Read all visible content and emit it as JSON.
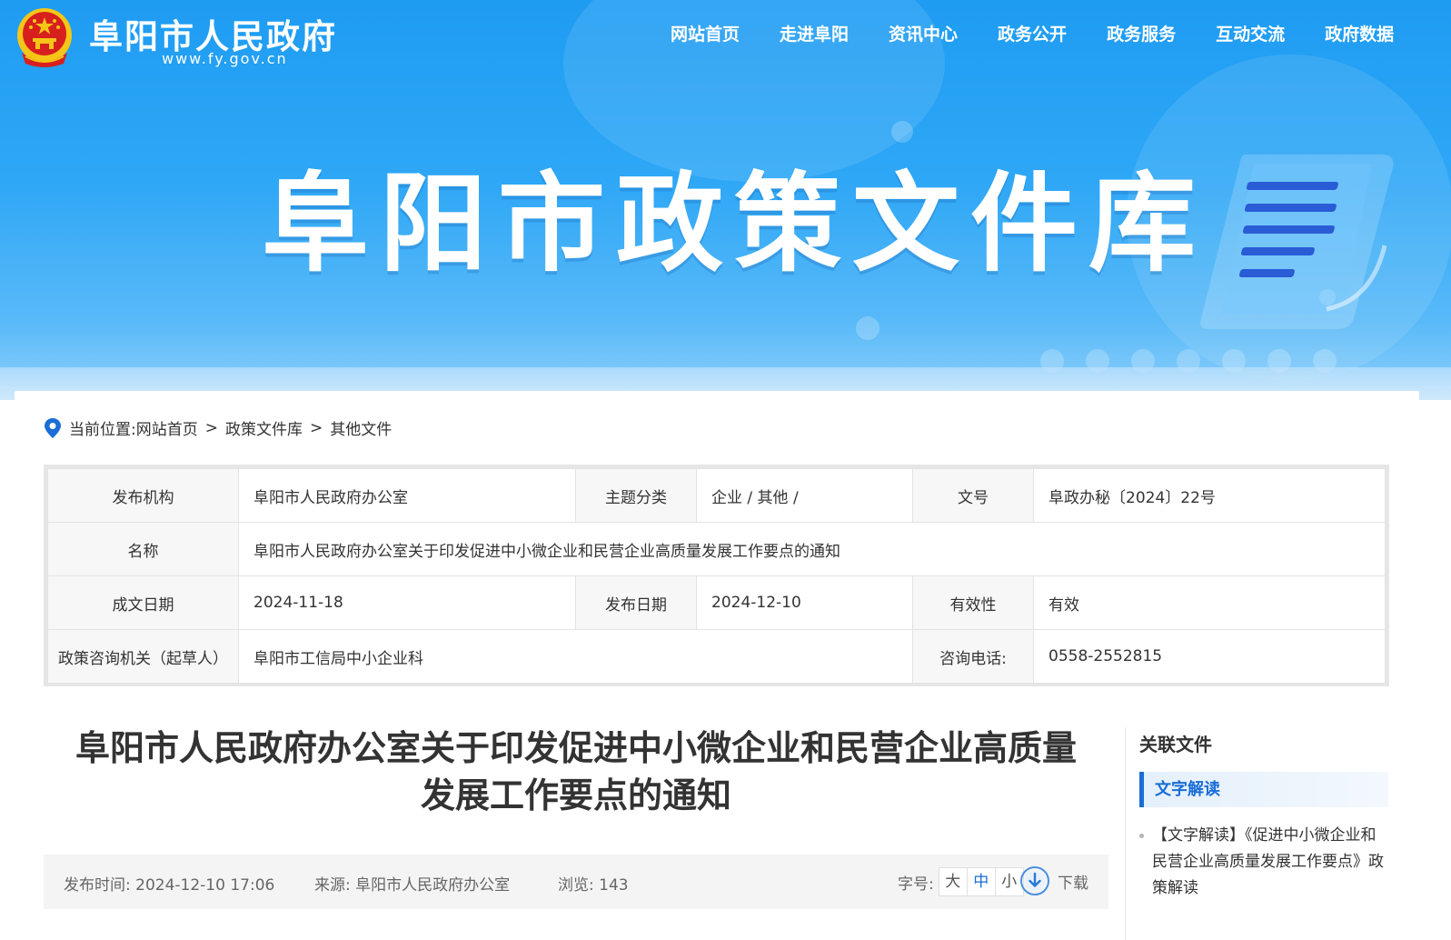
{
  "header": {
    "site_name": "阜阳市人民政府",
    "site_url": "www.fy.gov.cn",
    "nav": [
      "网站首页",
      "走进阜阳",
      "资讯中心",
      "政务公开",
      "政务服务",
      "互动交流",
      "政府数据"
    ]
  },
  "banner": {
    "title": "阜阳市政策文件库"
  },
  "breadcrumb": {
    "label": "当前位置:",
    "items": [
      "网站首页",
      "政策文件库",
      "其他文件"
    ],
    "separator": ">"
  },
  "info": {
    "issuer_label": "发布机构",
    "issuer": "阜阳市人民政府办公室",
    "topic_label": "主题分类",
    "topic": "企业 / 其他 /",
    "doc_no_label": "文号",
    "doc_no": "阜政办秘〔2024〕22号",
    "name_label": "名称",
    "name": "阜阳市人民政府办公室关于印发促进中小微企业和民营企业高质量发展工作要点的通知",
    "created_label": "成文日期",
    "created": "2024-11-18",
    "published_label": "发布日期",
    "published": "2024-12-10",
    "validity_label": "有效性",
    "validity": "有效",
    "consult_label": "政策咨询机关（起草人）",
    "consult": "阜阳市工信局中小企业科",
    "phone_label": "咨询电话:",
    "phone": "0558-2552815"
  },
  "article": {
    "title_line1": "阜阳市人民政府办公室关于印发促进中小微企业和民营企业高质量",
    "title_line2": "发展工作要点的通知",
    "publish_time": "发布时间: 2024-12-10 17:06",
    "source": "来源: 阜阳市人民政府办公室",
    "views": "浏览: 143",
    "font_size_label": "字号:",
    "font_sizes": [
      "大",
      "中",
      "小"
    ],
    "download_label": "下载"
  },
  "related": {
    "title": "关联文件",
    "tab": "文字解读",
    "items": [
      "【文字解读】《促进中小微企业和民营企业高质量发展工作要点》政策解读"
    ]
  },
  "colors": {
    "banner_blue": "#1e9cf2",
    "accent_blue": "#1a6dd6",
    "emblem_red": "#d7201e",
    "emblem_gold": "#f5c518"
  }
}
